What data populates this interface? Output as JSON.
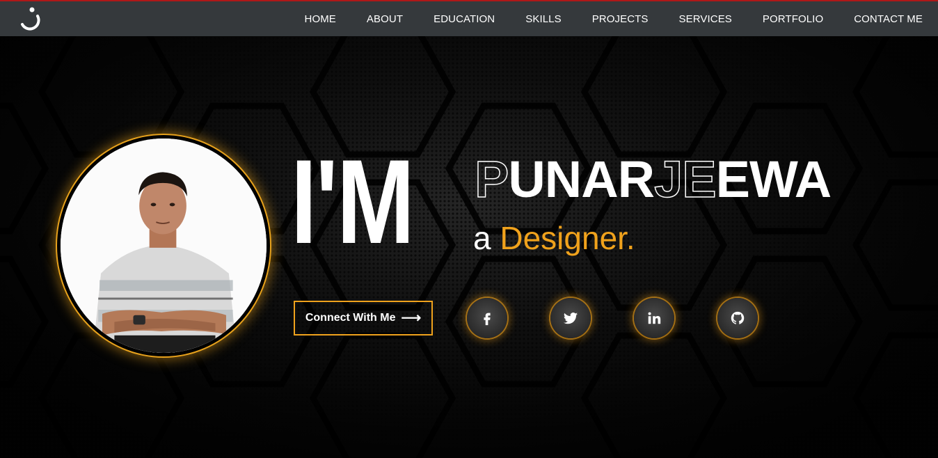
{
  "nav": {
    "logo_icon": "j-logo-icon",
    "items": [
      {
        "label": "HOME"
      },
      {
        "label": "ABOUT"
      },
      {
        "label": "EDUCATION"
      },
      {
        "label": "SKILLS"
      },
      {
        "label": "PROJECTS"
      },
      {
        "label": "SERVICES"
      },
      {
        "label": "PORTFOLIO"
      },
      {
        "label": "CONTACT ME"
      }
    ]
  },
  "hero": {
    "im": "I'M",
    "name_outline_part1": "P",
    "name_solid_part1": "UNAR",
    "name_outline_part2": "JE",
    "name_solid_part2": "EWA",
    "sub_prefix": "a ",
    "sub_role": "Designer.",
    "connect_label": "Connect With Me",
    "connect_arrow": "⟶",
    "accent_color": "#f0a21c"
  },
  "socials": [
    {
      "icon": "facebook-icon"
    },
    {
      "icon": "twitter-icon"
    },
    {
      "icon": "linkedin-icon"
    },
    {
      "icon": "github-icon"
    }
  ]
}
